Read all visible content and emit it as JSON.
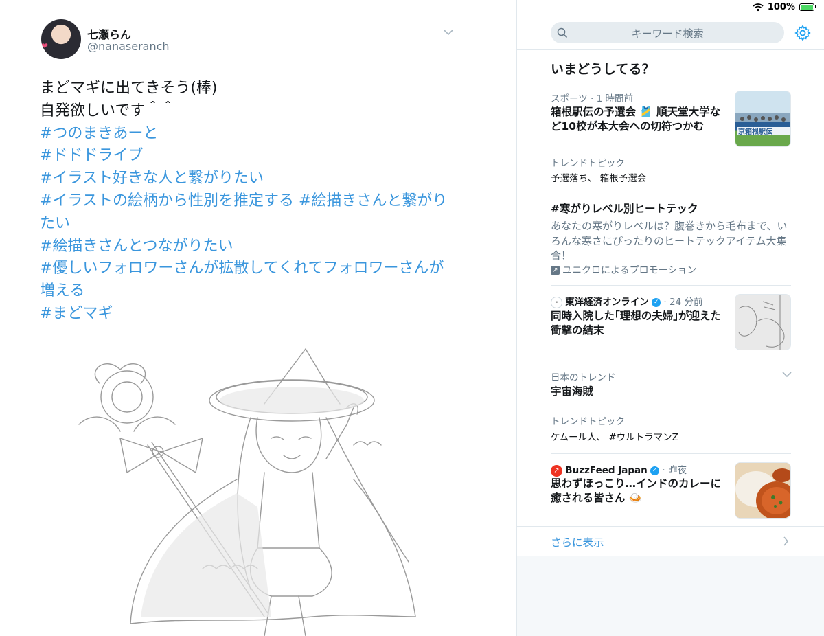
{
  "status_bar": {
    "battery": "100%"
  },
  "tweet": {
    "display_name": "七瀬らん",
    "handle": "@nanaseranch",
    "lines": [
      {
        "text": "まどマギに出てきそう(棒)",
        "type": "plain"
      },
      {
        "text": "自発欲しいです＾＾",
        "type": "plain"
      },
      {
        "text": "#つのまきあーと",
        "type": "tag"
      },
      {
        "text": "#ドドドライブ",
        "type": "tag"
      },
      {
        "text": "#イラスト好きな人と繋がりたい",
        "type": "tag"
      },
      {
        "text": "#イラストの絵柄から性別を推定する #絵描きさんと繋がり",
        "type": "tag"
      },
      {
        "text": "たい",
        "type": "tag"
      },
      {
        "text": "#絵描きさんとつながりたい",
        "type": "tag"
      },
      {
        "text": "#優しいフォロワーさんが拡散してくれてフォロワーさんが",
        "type": "tag"
      },
      {
        "text": "増える",
        "type": "tag"
      },
      {
        "text": "#まどマギ",
        "type": "tag"
      }
    ]
  },
  "search": {
    "placeholder": "キーワード検索"
  },
  "explore": {
    "title": "いまどうしてる？",
    "item1": {
      "meta": "スポーツ · 1 時間前",
      "headline": "箱根駅伝の予選会 🎽 順天堂大学など10校が本大会への切符つかむ"
    },
    "item2": {
      "meta": "トレンドトピック",
      "sub": "予選落ち、 箱根予選会"
    },
    "item3": {
      "headline": "#寒がりレベル別ヒートテック",
      "desc": "あなたの寒がりレベルは？腹巻きから毛布まで、いろんな寒さにぴったりのヒートテックアイテム大集合！",
      "promo": "ユニクロによるプロモーション"
    },
    "item4": {
      "source": "東洋経済オンライン",
      "time": "· 24 分前",
      "headline": "同時入院した｢理想の夫婦｣が迎えた衝撃の結末"
    },
    "item5": {
      "meta": "日本のトレンド",
      "headline": "宇宙海賊"
    },
    "item6": {
      "meta": "トレンドトピック",
      "sub": "ケムール人、 #ウルトラマンZ"
    },
    "item7": {
      "source": "BuzzFeed Japan",
      "time": "· 昨夜",
      "headline": "思わずほっこり…インドのカレーに癒される皆さん 🍛"
    },
    "more": "さらに表示"
  },
  "colors": {
    "link": "#3a96dd",
    "secondary_text": "#657786",
    "verified": "#1da1f2"
  }
}
